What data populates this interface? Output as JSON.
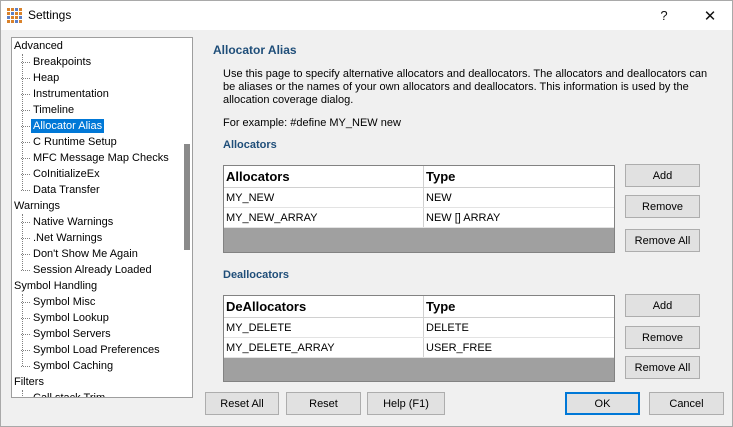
{
  "window": {
    "title": "Settings",
    "help": "?",
    "close": "✕"
  },
  "tree": {
    "items": [
      {
        "label": "Advanced",
        "level": 0
      },
      {
        "label": "Breakpoints",
        "level": 1
      },
      {
        "label": "Heap",
        "level": 1
      },
      {
        "label": "Instrumentation",
        "level": 1
      },
      {
        "label": "Timeline",
        "level": 1
      },
      {
        "label": "Allocator Alias",
        "level": 1,
        "selected": true
      },
      {
        "label": "C Runtime Setup",
        "level": 1
      },
      {
        "label": "MFC Message Map Checks",
        "level": 1
      },
      {
        "label": "CoInitializeEx",
        "level": 1
      },
      {
        "label": "Data Transfer",
        "level": 1
      },
      {
        "label": "Warnings",
        "level": 0
      },
      {
        "label": "Native Warnings",
        "level": 1
      },
      {
        "label": ".Net Warnings",
        "level": 1
      },
      {
        "label": "Don't Show Me Again",
        "level": 1
      },
      {
        "label": "Session Already Loaded",
        "level": 1
      },
      {
        "label": "Symbol Handling",
        "level": 0
      },
      {
        "label": "Symbol Misc",
        "level": 1
      },
      {
        "label": "Symbol Lookup",
        "level": 1
      },
      {
        "label": "Symbol Servers",
        "level": 1
      },
      {
        "label": "Symbol Load Preferences",
        "level": 1
      },
      {
        "label": "Symbol Caching",
        "level": 1
      },
      {
        "label": "Filters",
        "level": 0
      },
      {
        "label": "Call stack Trim",
        "level": 1
      }
    ]
  },
  "page": {
    "title": "Allocator Alias",
    "description": "Use this page to specify alternative allocators and deallocators. The allocators and deallocators can be aliases or the names of your own allocators and deallocators. This information is used by the allocation coverage dialog.",
    "example": "For example: #define MY_NEW new"
  },
  "allocators": {
    "heading": "Allocators",
    "columns": [
      "Allocators",
      "Type"
    ],
    "rows": [
      [
        "MY_NEW",
        "NEW"
      ],
      [
        "MY_NEW_ARRAY",
        "NEW [] ARRAY"
      ]
    ],
    "buttons": {
      "add": "Add",
      "remove": "Remove",
      "remove_all": "Remove All"
    }
  },
  "deallocators": {
    "heading": "Deallocators",
    "columns": [
      "DeAllocators",
      "Type"
    ],
    "rows": [
      [
        "MY_DELETE",
        "DELETE"
      ],
      [
        "MY_DELETE_ARRAY",
        "USER_FREE"
      ]
    ],
    "buttons": {
      "add": "Add",
      "remove": "Remove",
      "remove_all": "Remove All"
    }
  },
  "footer": {
    "reset_all": "Reset All",
    "reset": "Reset",
    "help": "Help (F1)",
    "ok": "OK",
    "cancel": "Cancel"
  },
  "colors": {
    "accent": "#0078d7",
    "heading": "#1f4e79"
  }
}
